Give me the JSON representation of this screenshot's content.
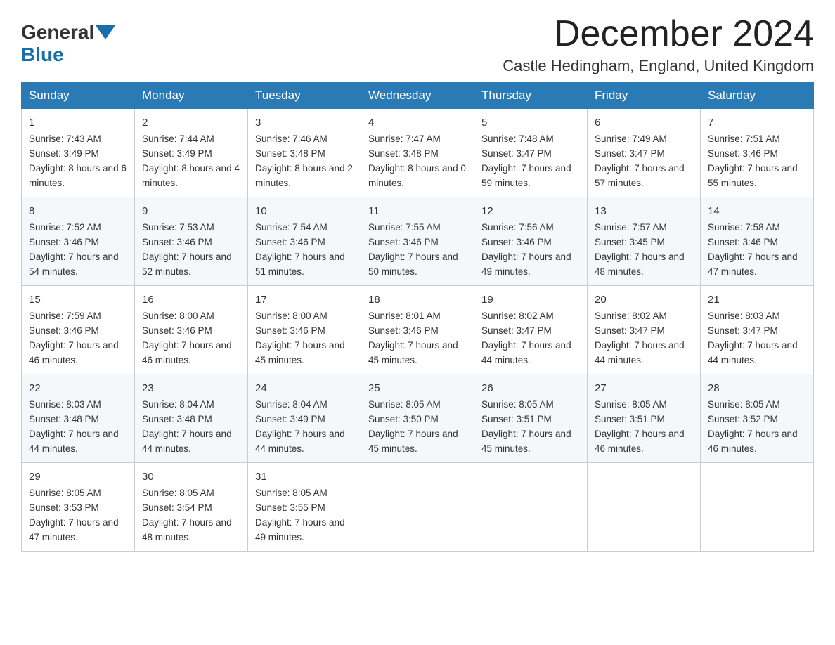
{
  "header": {
    "logo_general": "General",
    "logo_blue": "Blue",
    "month_title": "December 2024",
    "location": "Castle Hedingham, England, United Kingdom"
  },
  "days_of_week": [
    "Sunday",
    "Monday",
    "Tuesday",
    "Wednesday",
    "Thursday",
    "Friday",
    "Saturday"
  ],
  "weeks": [
    [
      {
        "day": "1",
        "sunrise": "7:43 AM",
        "sunset": "3:49 PM",
        "daylight": "8 hours and 6 minutes."
      },
      {
        "day": "2",
        "sunrise": "7:44 AM",
        "sunset": "3:49 PM",
        "daylight": "8 hours and 4 minutes."
      },
      {
        "day": "3",
        "sunrise": "7:46 AM",
        "sunset": "3:48 PM",
        "daylight": "8 hours and 2 minutes."
      },
      {
        "day": "4",
        "sunrise": "7:47 AM",
        "sunset": "3:48 PM",
        "daylight": "8 hours and 0 minutes."
      },
      {
        "day": "5",
        "sunrise": "7:48 AM",
        "sunset": "3:47 PM",
        "daylight": "7 hours and 59 minutes."
      },
      {
        "day": "6",
        "sunrise": "7:49 AM",
        "sunset": "3:47 PM",
        "daylight": "7 hours and 57 minutes."
      },
      {
        "day": "7",
        "sunrise": "7:51 AM",
        "sunset": "3:46 PM",
        "daylight": "7 hours and 55 minutes."
      }
    ],
    [
      {
        "day": "8",
        "sunrise": "7:52 AM",
        "sunset": "3:46 PM",
        "daylight": "7 hours and 54 minutes."
      },
      {
        "day": "9",
        "sunrise": "7:53 AM",
        "sunset": "3:46 PM",
        "daylight": "7 hours and 52 minutes."
      },
      {
        "day": "10",
        "sunrise": "7:54 AM",
        "sunset": "3:46 PM",
        "daylight": "7 hours and 51 minutes."
      },
      {
        "day": "11",
        "sunrise": "7:55 AM",
        "sunset": "3:46 PM",
        "daylight": "7 hours and 50 minutes."
      },
      {
        "day": "12",
        "sunrise": "7:56 AM",
        "sunset": "3:46 PM",
        "daylight": "7 hours and 49 minutes."
      },
      {
        "day": "13",
        "sunrise": "7:57 AM",
        "sunset": "3:45 PM",
        "daylight": "7 hours and 48 minutes."
      },
      {
        "day": "14",
        "sunrise": "7:58 AM",
        "sunset": "3:46 PM",
        "daylight": "7 hours and 47 minutes."
      }
    ],
    [
      {
        "day": "15",
        "sunrise": "7:59 AM",
        "sunset": "3:46 PM",
        "daylight": "7 hours and 46 minutes."
      },
      {
        "day": "16",
        "sunrise": "8:00 AM",
        "sunset": "3:46 PM",
        "daylight": "7 hours and 46 minutes."
      },
      {
        "day": "17",
        "sunrise": "8:00 AM",
        "sunset": "3:46 PM",
        "daylight": "7 hours and 45 minutes."
      },
      {
        "day": "18",
        "sunrise": "8:01 AM",
        "sunset": "3:46 PM",
        "daylight": "7 hours and 45 minutes."
      },
      {
        "day": "19",
        "sunrise": "8:02 AM",
        "sunset": "3:47 PM",
        "daylight": "7 hours and 44 minutes."
      },
      {
        "day": "20",
        "sunrise": "8:02 AM",
        "sunset": "3:47 PM",
        "daylight": "7 hours and 44 minutes."
      },
      {
        "day": "21",
        "sunrise": "8:03 AM",
        "sunset": "3:47 PM",
        "daylight": "7 hours and 44 minutes."
      }
    ],
    [
      {
        "day": "22",
        "sunrise": "8:03 AM",
        "sunset": "3:48 PM",
        "daylight": "7 hours and 44 minutes."
      },
      {
        "day": "23",
        "sunrise": "8:04 AM",
        "sunset": "3:48 PM",
        "daylight": "7 hours and 44 minutes."
      },
      {
        "day": "24",
        "sunrise": "8:04 AM",
        "sunset": "3:49 PM",
        "daylight": "7 hours and 44 minutes."
      },
      {
        "day": "25",
        "sunrise": "8:05 AM",
        "sunset": "3:50 PM",
        "daylight": "7 hours and 45 minutes."
      },
      {
        "day": "26",
        "sunrise": "8:05 AM",
        "sunset": "3:51 PM",
        "daylight": "7 hours and 45 minutes."
      },
      {
        "day": "27",
        "sunrise": "8:05 AM",
        "sunset": "3:51 PM",
        "daylight": "7 hours and 46 minutes."
      },
      {
        "day": "28",
        "sunrise": "8:05 AM",
        "sunset": "3:52 PM",
        "daylight": "7 hours and 46 minutes."
      }
    ],
    [
      {
        "day": "29",
        "sunrise": "8:05 AM",
        "sunset": "3:53 PM",
        "daylight": "7 hours and 47 minutes."
      },
      {
        "day": "30",
        "sunrise": "8:05 AM",
        "sunset": "3:54 PM",
        "daylight": "7 hours and 48 minutes."
      },
      {
        "day": "31",
        "sunrise": "8:05 AM",
        "sunset": "3:55 PM",
        "daylight": "7 hours and 49 minutes."
      },
      null,
      null,
      null,
      null
    ]
  ],
  "labels": {
    "sunrise": "Sunrise:",
    "sunset": "Sunset:",
    "daylight": "Daylight:"
  }
}
